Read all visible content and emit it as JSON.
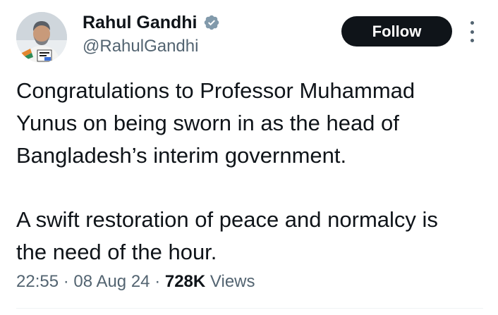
{
  "author": {
    "name": "Rahul Gandhi",
    "handle": "@RahulGandhi",
    "verified": true,
    "verified_color": "#829aab"
  },
  "actions": {
    "follow_label": "Follow",
    "more_icon": "more-vertical-icon"
  },
  "tweet": {
    "paragraph1": "Congratulations to Professor Muhammad\nYunus on being sworn in as the head of\nBangladesh’s interim government.",
    "paragraph2": "A swift restoration of peace and normalcy is\nthe need of the hour."
  },
  "meta": {
    "time": "22:55",
    "separator": "·",
    "date": "08 Aug 24",
    "views_count": "728K",
    "views_label": "Views"
  },
  "colors": {
    "text_primary": "#0f1419",
    "text_secondary": "#536471",
    "button_bg": "#0f1419",
    "button_text": "#ffffff"
  }
}
